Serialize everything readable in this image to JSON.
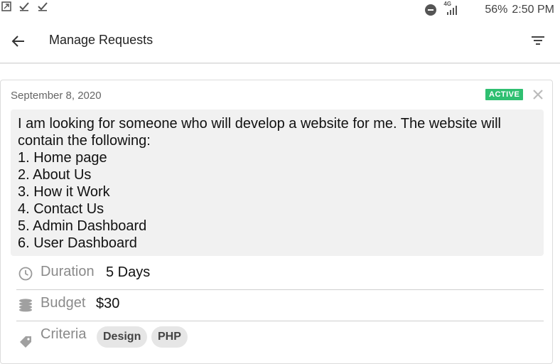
{
  "status_bar": {
    "left_icons": [
      "screenshot-icon",
      "check-icon",
      "check-icon"
    ],
    "network_type": "4G",
    "battery": "56%",
    "time": "2:50 PM"
  },
  "app_bar": {
    "title": "Manage Requests"
  },
  "request": {
    "date": "September 8, 2020",
    "status": "ACTIVE",
    "status_color": "#2fbf71",
    "description_lines": [
      "I am looking for someone who will develop a website for me. The website will",
      "contain the following:",
      "1. Home page",
      "2. About Us",
      "3. How it Work",
      "4. Contact Us",
      "5. Admin Dashboard",
      "6. User Dashboard"
    ],
    "duration_label": "Duration",
    "duration_value": "5 Days",
    "budget_label": "Budget",
    "budget_value": "$30",
    "criteria_label": "Criteria",
    "criteria_tags": [
      "Design",
      "PHP"
    ]
  }
}
